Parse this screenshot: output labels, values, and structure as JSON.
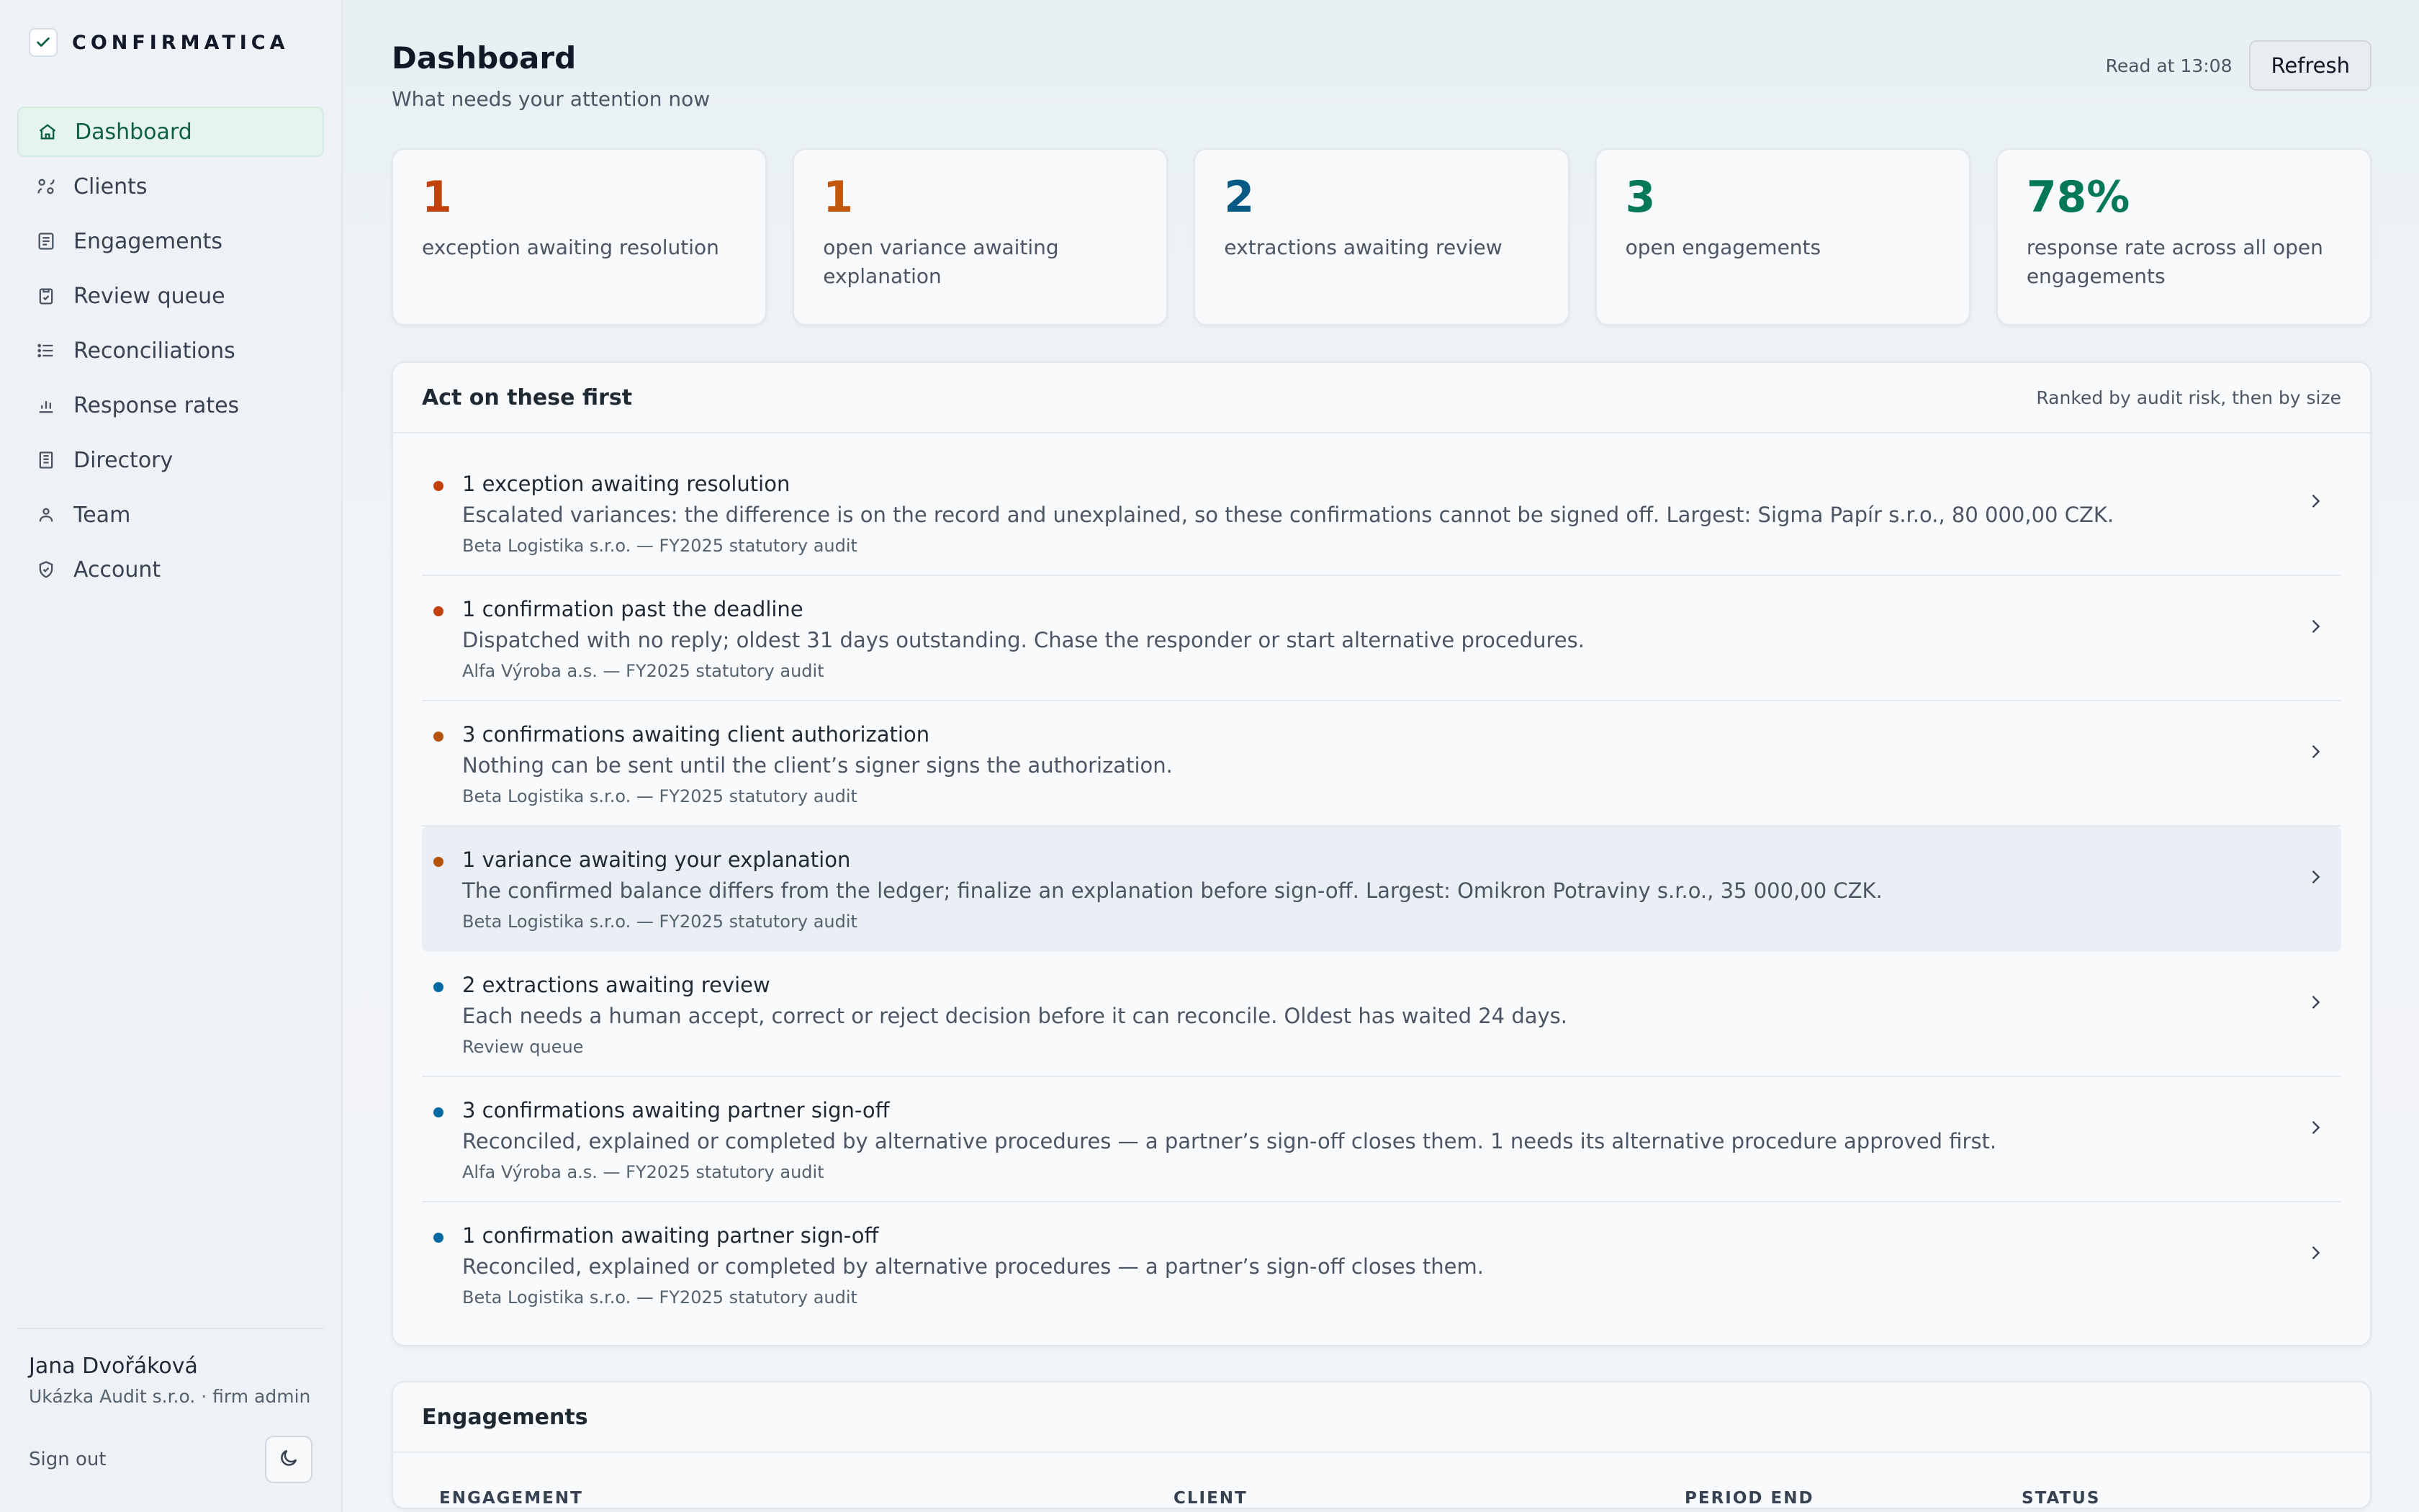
{
  "brand": {
    "name": "CONFIRMATICA"
  },
  "nav": [
    {
      "label": "Dashboard",
      "icon": "home-icon",
      "active": true
    },
    {
      "label": "Clients",
      "icon": "clients-icon"
    },
    {
      "label": "Engagements",
      "icon": "document-icon"
    },
    {
      "label": "Review queue",
      "icon": "clipboard-check-icon"
    },
    {
      "label": "Reconciliations",
      "icon": "list-icon"
    },
    {
      "label": "Response rates",
      "icon": "bar-chart-icon"
    },
    {
      "label": "Directory",
      "icon": "directory-icon"
    },
    {
      "label": "Team",
      "icon": "team-icon"
    },
    {
      "label": "Account",
      "icon": "shield-icon"
    }
  ],
  "user": {
    "name": "Jana Dvořáková",
    "org": "Ukázka Audit s.r.o. · firm admin",
    "sign_out": "Sign out"
  },
  "header": {
    "title": "Dashboard",
    "subtitle": "What needs your attention now",
    "read_at": "Read at 13:08",
    "refresh": "Refresh"
  },
  "stats": [
    {
      "value": "1",
      "label": "exception awaiting resolution",
      "color": "#c2410c"
    },
    {
      "value": "1",
      "label": "open variance awaiting explanation",
      "color": "#c2570c"
    },
    {
      "value": "2",
      "label": "extractions awaiting review",
      "color": "#075985"
    },
    {
      "value": "3",
      "label": "open engagements",
      "color": "#047857"
    },
    {
      "value": "78%",
      "label": "response rate across all open engagements",
      "color": "#047857"
    }
  ],
  "act": {
    "title": "Act on these first",
    "note": "Ranked by audit risk, then by size",
    "items": [
      {
        "title": "1 exception awaiting resolution",
        "desc": "Escalated variances: the difference is on the record and unexplained, so these confirmations cannot be signed off. Largest: Sigma Papír s.r.o., 80 000,00 CZK.",
        "meta": "Beta Logistika s.r.o. — FY2025 statutory audit",
        "dot": "#c2410c"
      },
      {
        "title": "1 confirmation past the deadline",
        "desc": "Dispatched with no reply; oldest 31 days outstanding. Chase the responder or start alternative procedures.",
        "meta": "Alfa Výroba a.s. — FY2025 statutory audit",
        "dot": "#c2410c"
      },
      {
        "title": "3 confirmations awaiting client authorization",
        "desc": "Nothing can be sent until the client’s signer signs the authorization.",
        "meta": "Beta Logistika s.r.o. — FY2025 statutory audit",
        "dot": "#b45309"
      },
      {
        "title": "1 variance awaiting your explanation",
        "desc": "The confirmed balance differs from the ledger; finalize an explanation before sign-off. Largest: Omikron Potraviny s.r.o., 35 000,00 CZK.",
        "meta": "Beta Logistika s.r.o. — FY2025 statutory audit",
        "dot": "#b45309",
        "highlight": true
      },
      {
        "title": "2 extractions awaiting review",
        "desc": "Each needs a human accept, correct or reject decision before it can reconcile. Oldest has waited 24 days.",
        "meta": "Review queue",
        "dot": "#0369a1"
      },
      {
        "title": "3 confirmations awaiting partner sign-off",
        "desc": "Reconciled, explained or completed by alternative procedures — a partner’s sign-off closes them. 1 needs its alternative procedure approved first.",
        "meta": "Alfa Výroba a.s. — FY2025 statutory audit",
        "dot": "#0369a1"
      },
      {
        "title": "1 confirmation awaiting partner sign-off",
        "desc": "Reconciled, explained or completed by alternative procedures — a partner’s sign-off closes them.",
        "meta": "Beta Logistika s.r.o. — FY2025 statutory audit",
        "dot": "#0369a1"
      }
    ]
  },
  "engagements": {
    "title": "Engagements",
    "columns": [
      "ENGAGEMENT",
      "CLIENT",
      "PERIOD END",
      "STATUS"
    ]
  }
}
